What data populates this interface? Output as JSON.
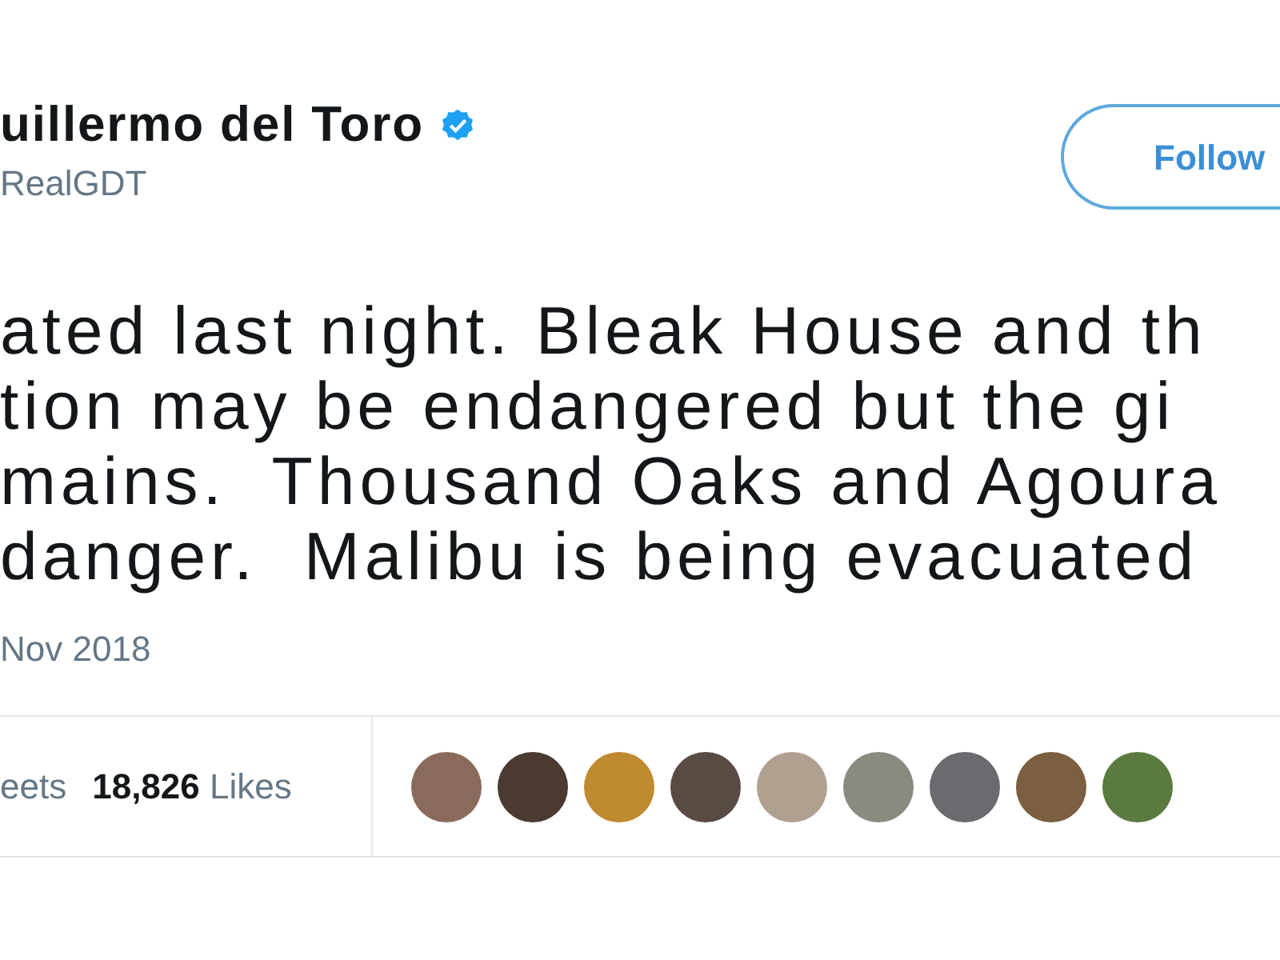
{
  "author": {
    "name": "uillermo del Toro",
    "handle": "RealGDT",
    "verified": true
  },
  "follow_button": {
    "label": "Follow"
  },
  "tweet_lines": [
    "ated last night. Bleak House and th",
    "tion may be endangered but the gi",
    "mains.  Thousand Oaks and Agoura",
    "danger.  Malibu is being evacuated"
  ],
  "date": "Nov 2018",
  "stats": [
    {
      "label": "eets"
    },
    {
      "count": "18,826",
      "label": "Likes"
    }
  ]
}
